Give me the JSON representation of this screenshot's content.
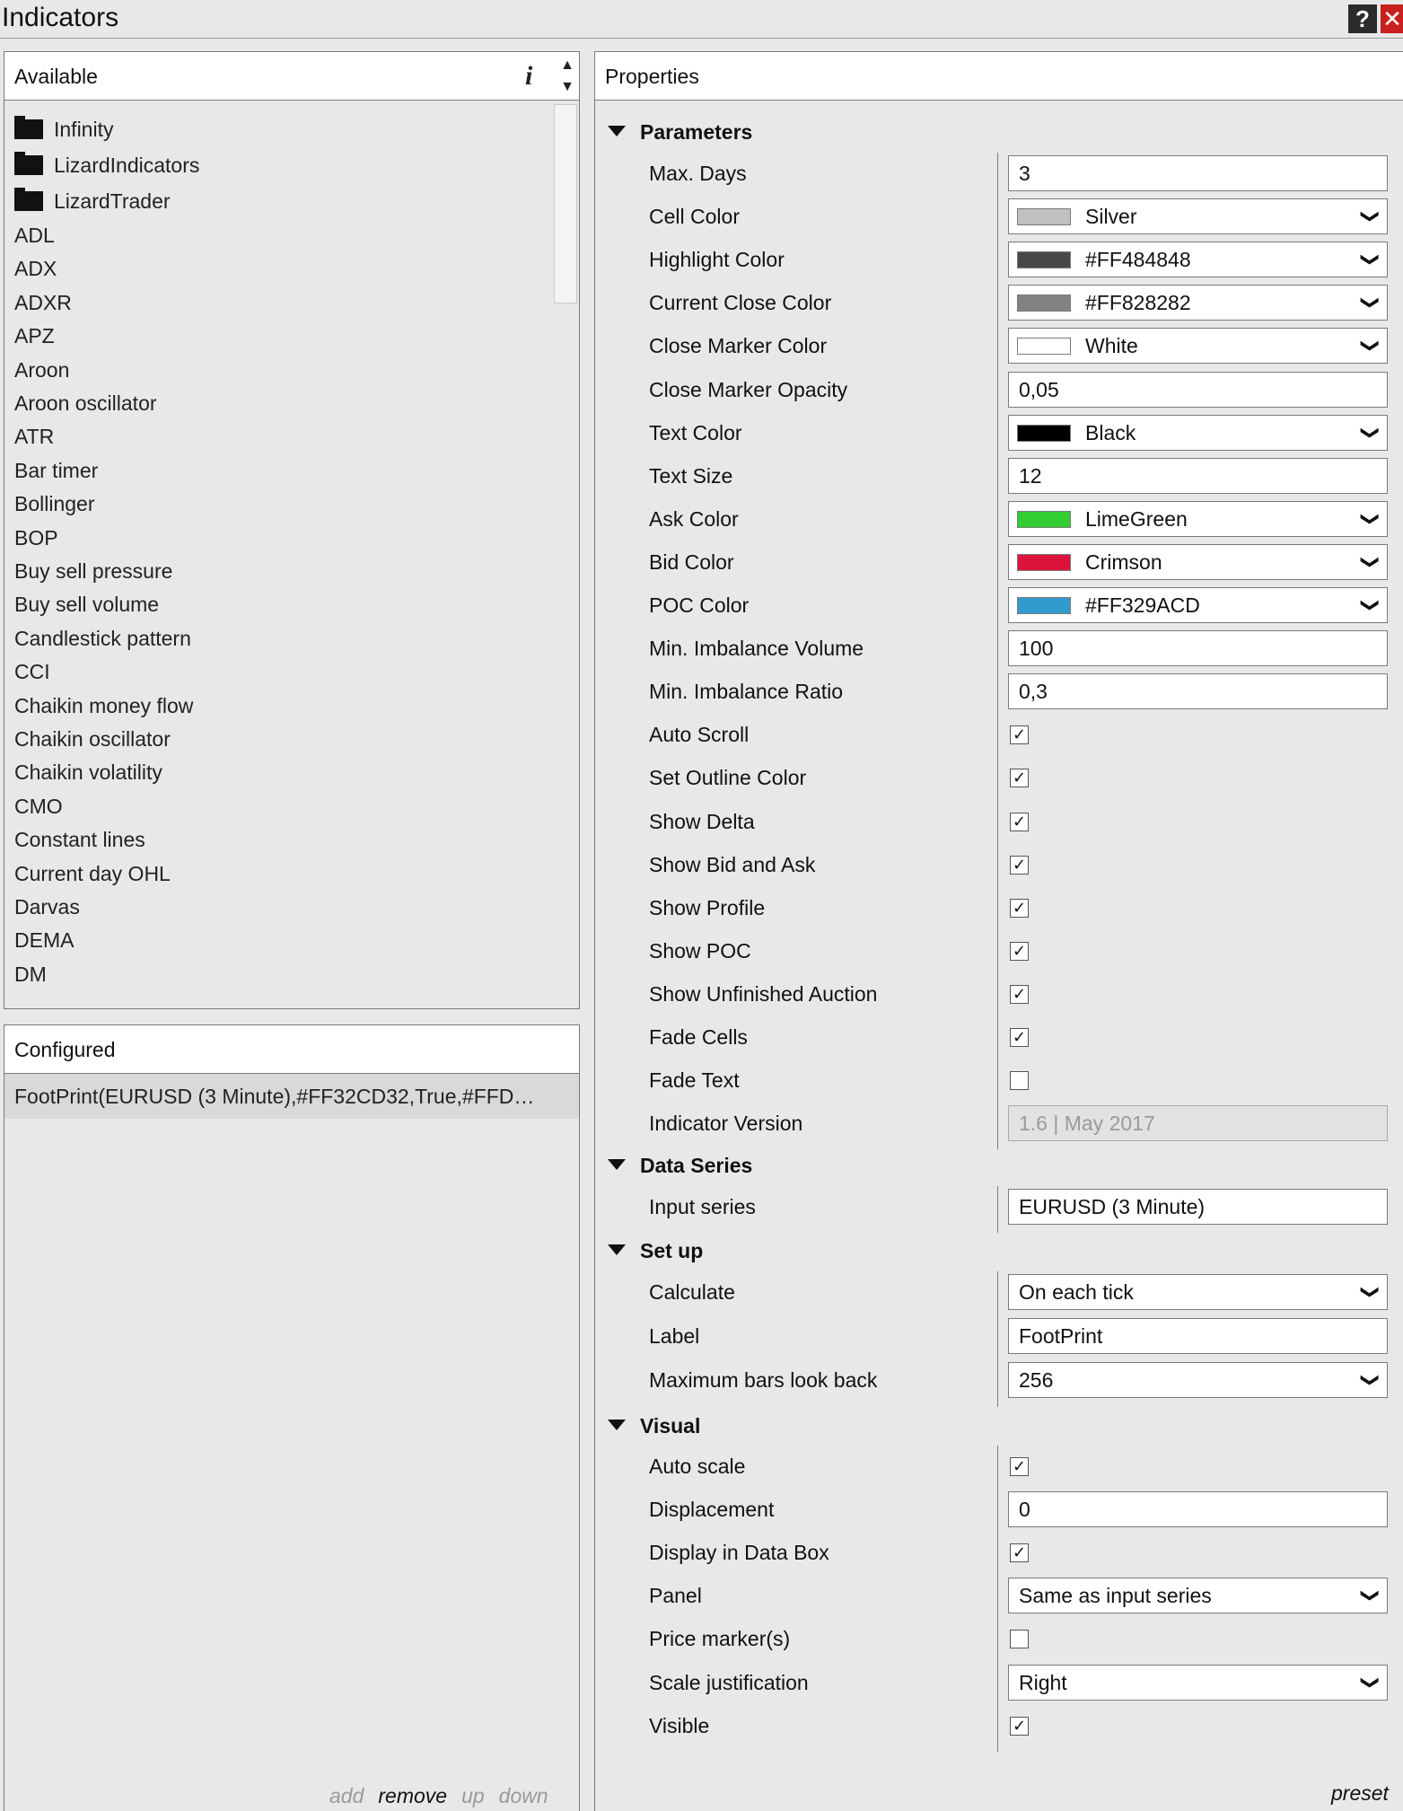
{
  "window": {
    "title": "Indicators",
    "help": "?",
    "close": "✕"
  },
  "available": {
    "header": "Available",
    "info": "i",
    "up": "▲",
    "down": "▼",
    "folders": [
      "Infinity",
      "LizardIndicators",
      "LizardTrader"
    ],
    "items": [
      "ADL",
      "ADX",
      "ADXR",
      "APZ",
      "Aroon",
      "Aroon oscillator",
      "ATR",
      "Bar timer",
      "Bollinger",
      "BOP",
      "Buy sell pressure",
      "Buy sell volume",
      "Candlestick pattern",
      "CCI",
      "Chaikin money flow",
      "Chaikin oscillator",
      "Chaikin volatility",
      "CMO",
      "Constant lines",
      "Current day OHL",
      "Darvas",
      "DEMA",
      "DM"
    ]
  },
  "configured": {
    "header": "Configured",
    "item": "FootPrint(EURUSD (3 Minute),#FF32CD32,True,#FFD…",
    "actions": {
      "add": "add",
      "remove": "remove",
      "up": "up",
      "down": "down"
    }
  },
  "properties": {
    "header": "Properties",
    "preset": "preset",
    "sections": {
      "parameters": "Parameters",
      "data_series": "Data Series",
      "setup": "Set up",
      "visual": "Visual"
    },
    "params": [
      {
        "label": "Max. Days",
        "type": "text",
        "value": "3"
      },
      {
        "label": "Cell Color",
        "type": "color",
        "value": "Silver",
        "color": "#C0C0C0"
      },
      {
        "label": "Highlight Color",
        "type": "color",
        "value": "#FF484848",
        "color": "#484848"
      },
      {
        "label": "Current Close Color",
        "type": "color",
        "value": "#FF828282",
        "color": "#828282"
      },
      {
        "label": "Close Marker Color",
        "type": "color",
        "value": "White",
        "color": "#FFFFFF"
      },
      {
        "label": "Close Marker Opacity",
        "type": "text",
        "value": "0,05"
      },
      {
        "label": "Text Color",
        "type": "color",
        "value": "Black",
        "color": "#000000"
      },
      {
        "label": "Text Size",
        "type": "text",
        "value": "12"
      },
      {
        "label": "Ask Color",
        "type": "color",
        "value": "LimeGreen",
        "color": "#32CD32"
      },
      {
        "label": "Bid Color",
        "type": "color",
        "value": "Crimson",
        "color": "#DC143C"
      },
      {
        "label": "POC Color",
        "type": "color",
        "value": "#FF329ACD",
        "color": "#329ACD"
      },
      {
        "label": "Min. Imbalance Volume",
        "type": "text",
        "value": "100"
      },
      {
        "label": "Min. Imbalance Ratio",
        "type": "text",
        "value": "0,3"
      },
      {
        "label": "Auto Scroll",
        "type": "check",
        "checked": true
      },
      {
        "label": "Set Outline Color",
        "type": "check",
        "checked": true
      },
      {
        "label": "Show Delta",
        "type": "check",
        "checked": true
      },
      {
        "label": "Show Bid and Ask",
        "type": "check",
        "checked": true
      },
      {
        "label": "Show Profile",
        "type": "check",
        "checked": true
      },
      {
        "label": "Show POC",
        "type": "check",
        "checked": true
      },
      {
        "label": "Show Unfinished Auction",
        "type": "check",
        "checked": true
      },
      {
        "label": "Fade Cells",
        "type": "check",
        "checked": true
      },
      {
        "label": "Fade Text",
        "type": "check",
        "checked": false
      },
      {
        "label": "Indicator Version",
        "type": "disabled",
        "value": "1.6 | May 2017"
      }
    ],
    "data_series": [
      {
        "label": "Input series",
        "type": "text",
        "value": "EURUSD (3 Minute)"
      }
    ],
    "setup": [
      {
        "label": "Calculate",
        "type": "select",
        "value": "On each tick"
      },
      {
        "label": "Label",
        "type": "text",
        "value": "FootPrint"
      },
      {
        "label": "Maximum bars look back",
        "type": "select",
        "value": "256"
      }
    ],
    "visual": [
      {
        "label": "Auto scale",
        "type": "check",
        "checked": true
      },
      {
        "label": "Displacement",
        "type": "text",
        "value": "0"
      },
      {
        "label": "Display in Data Box",
        "type": "check",
        "checked": true
      },
      {
        "label": "Panel",
        "type": "select",
        "value": "Same as input series"
      },
      {
        "label": "Price marker(s)",
        "type": "check",
        "checked": false
      },
      {
        "label": "Scale justification",
        "type": "select",
        "value": "Right"
      },
      {
        "label": "Visible",
        "type": "check",
        "checked": true
      }
    ]
  }
}
